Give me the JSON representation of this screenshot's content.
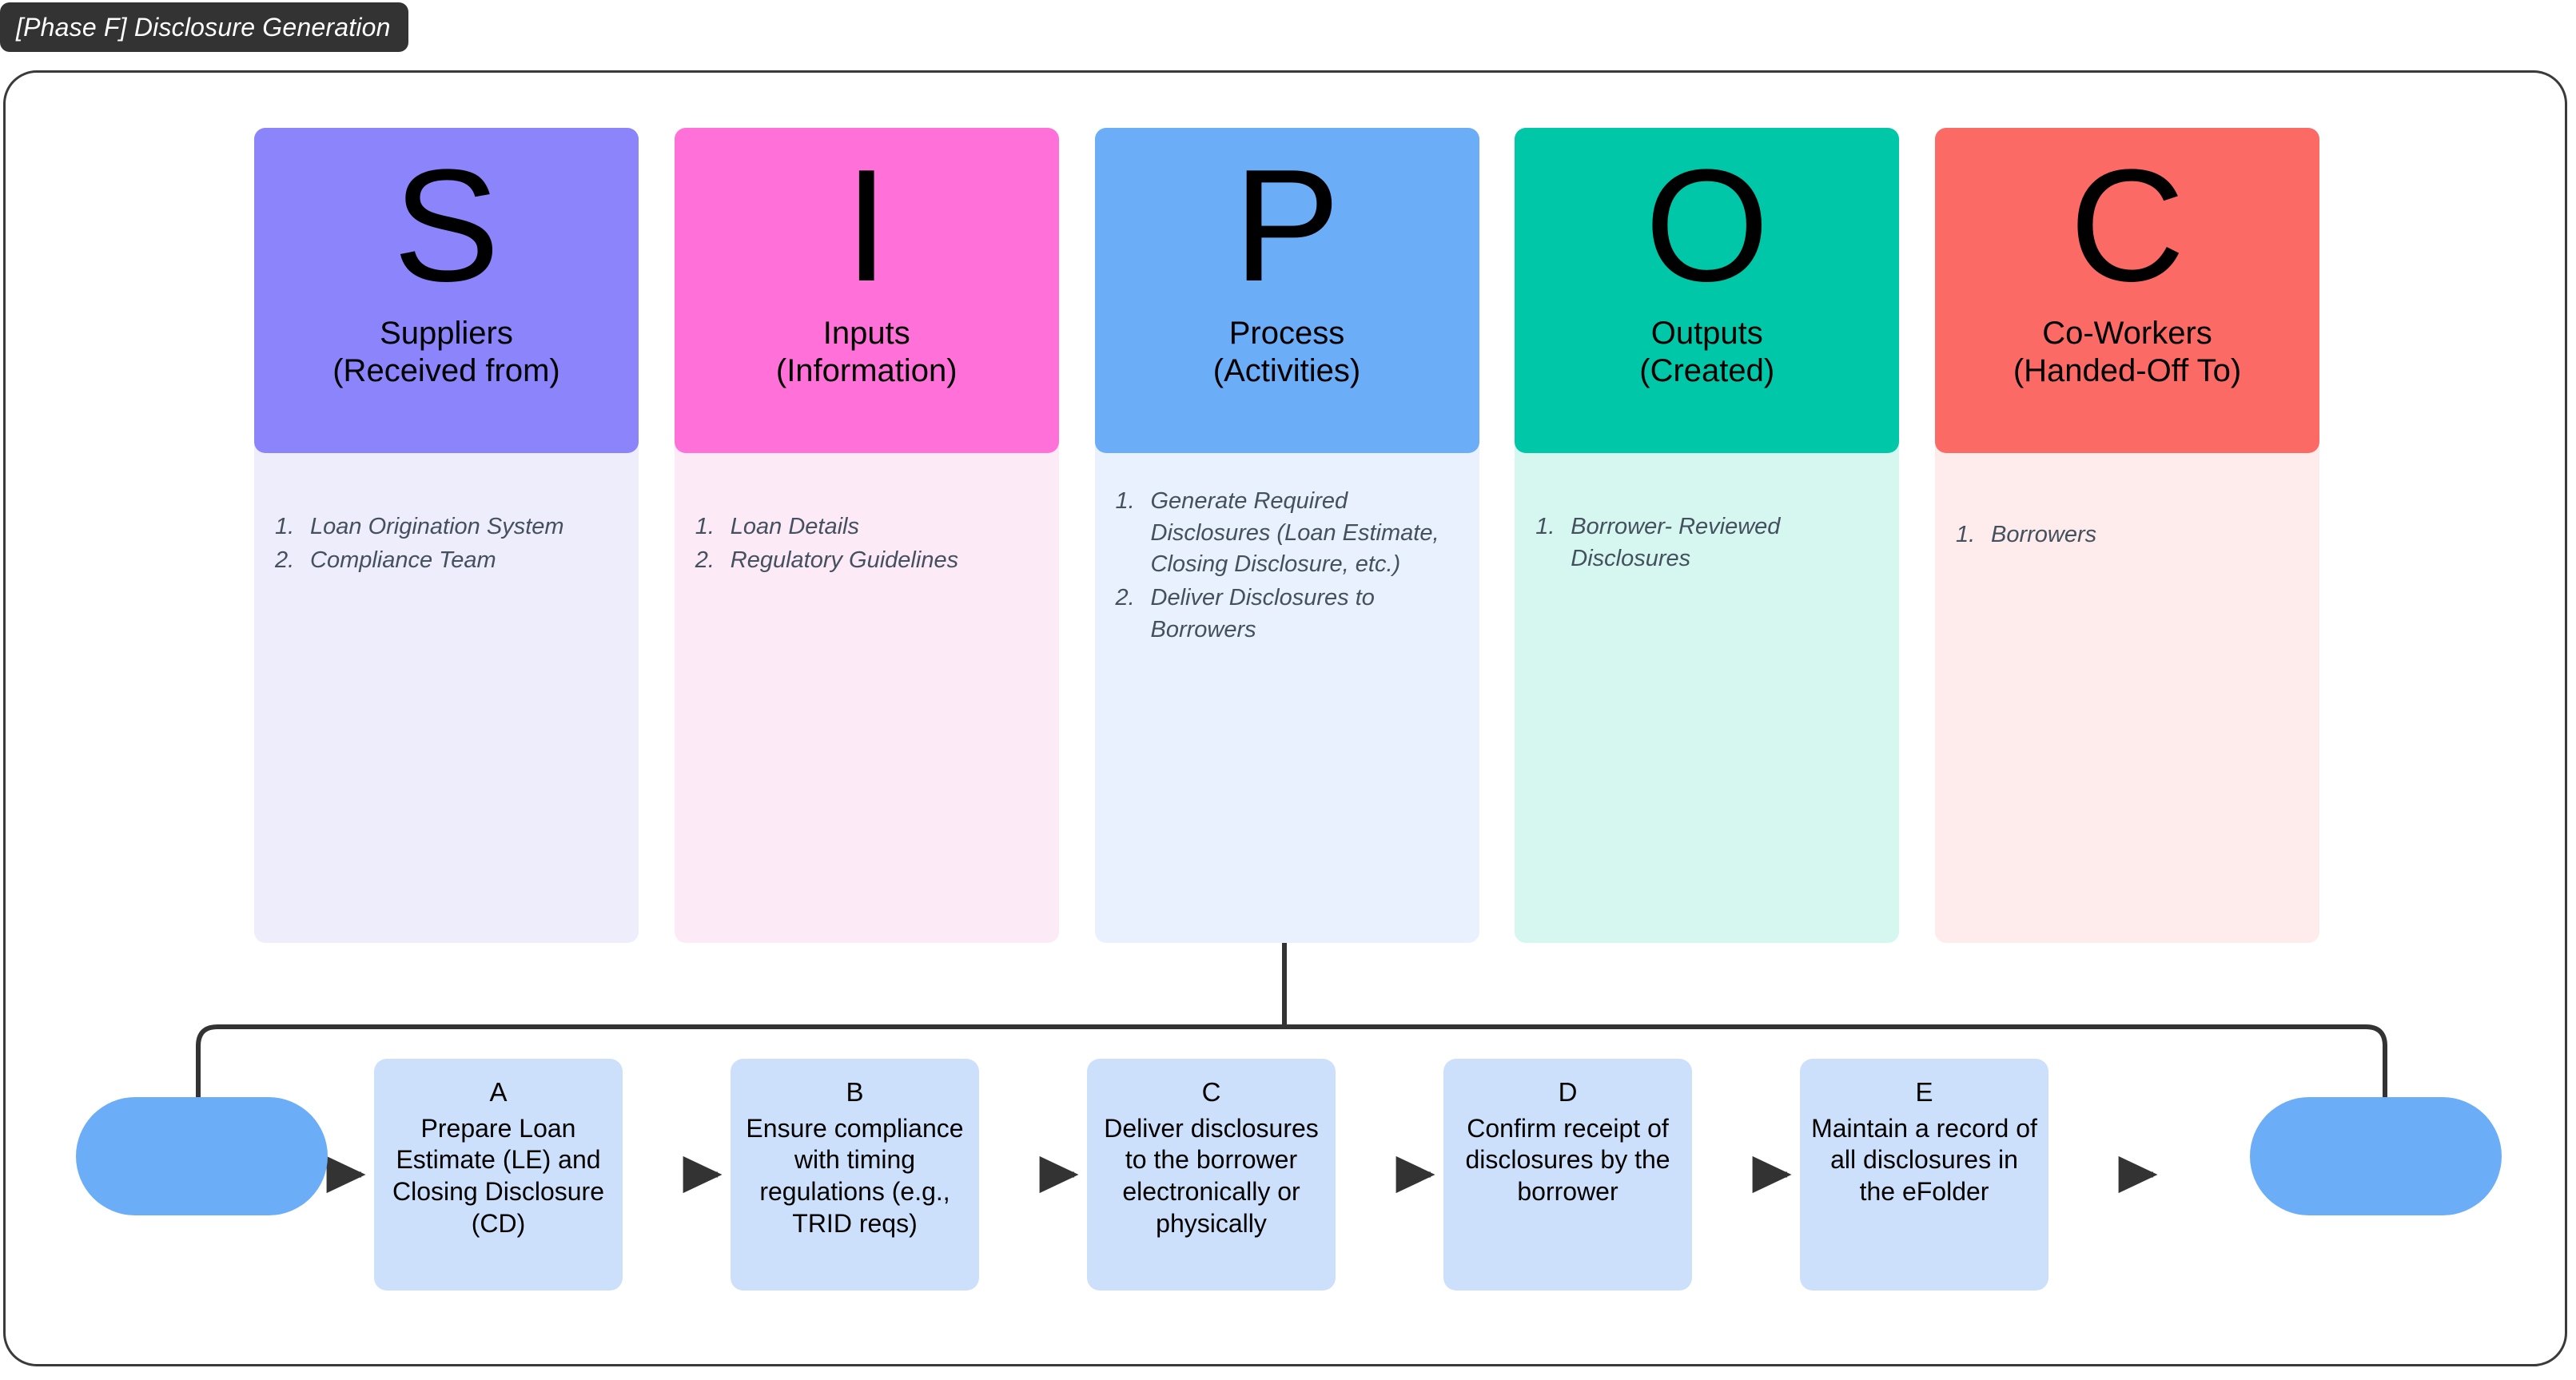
{
  "phase": {
    "badge_label": "[Phase F] Disclosure Generation"
  },
  "colors": {
    "suppliers_header": "#8b84fa",
    "suppliers_body": "#eeedfb",
    "inputs_header": "#ff70d9",
    "inputs_body": "#fdeaf7",
    "process_header": "#6badf7",
    "process_body": "#e8f1fd",
    "outputs_header": "#00c7a8",
    "outputs_body": "#d6f7ef",
    "coworkers_header": "#fc6a66",
    "coworkers_body": "#fdeceb",
    "flow_step": "#cce0fb",
    "terminator": "#6badf7",
    "connector": "#333333",
    "frame_border": "#3a3a3a",
    "badge_bg": "#333333"
  },
  "sipoc": {
    "columns": [
      {
        "letter": "S",
        "title_line1": "Suppliers",
        "title_line2": "(Received from)",
        "items": [
          {
            "num": "1.",
            "text": "Loan Origination System"
          },
          {
            "num": "2.",
            "text": "Compliance Team"
          }
        ]
      },
      {
        "letter": "I",
        "title_line1": "Inputs",
        "title_line2": "(Information)",
        "items": [
          {
            "num": "1.",
            "text": "Loan Details"
          },
          {
            "num": "2.",
            "text": "Regulatory Guidelines"
          }
        ]
      },
      {
        "letter": "P",
        "title_line1": "Process",
        "title_line2": "(Activities)",
        "items": [
          {
            "num": "1.",
            "text": "Generate Required Disclosures (Loan Estimate, Closing Disclosure, etc.)"
          },
          {
            "num": "2.",
            "text": "Deliver Disclosures to Borrowers"
          }
        ]
      },
      {
        "letter": "O",
        "title_line1": "Outputs",
        "title_line2": "(Created)",
        "items": [
          {
            "num": "1.",
            "text": "Borrower- Reviewed Disclosures"
          }
        ]
      },
      {
        "letter": "C",
        "title_line1": "Co-Workers",
        "title_line2": "(Handed-Off To)",
        "items": [
          {
            "num": "1.",
            "text": "Borrowers"
          }
        ]
      }
    ]
  },
  "flow": {
    "start_label": "",
    "end_label": "",
    "steps": [
      {
        "id": "A",
        "text": "Prepare Loan Estimate (LE) and Closing Disclosure (CD)"
      },
      {
        "id": "B",
        "text": "Ensure compliance with timing regulations (e.g., TRID reqs)"
      },
      {
        "id": "C",
        "text": "Deliver disclosures to the borrower electronically or physically"
      },
      {
        "id": "D",
        "text": "Confirm receipt of disclosures by the borrower"
      },
      {
        "id": "E",
        "text": "Maintain a record of all disclosures in the eFolder"
      }
    ]
  }
}
